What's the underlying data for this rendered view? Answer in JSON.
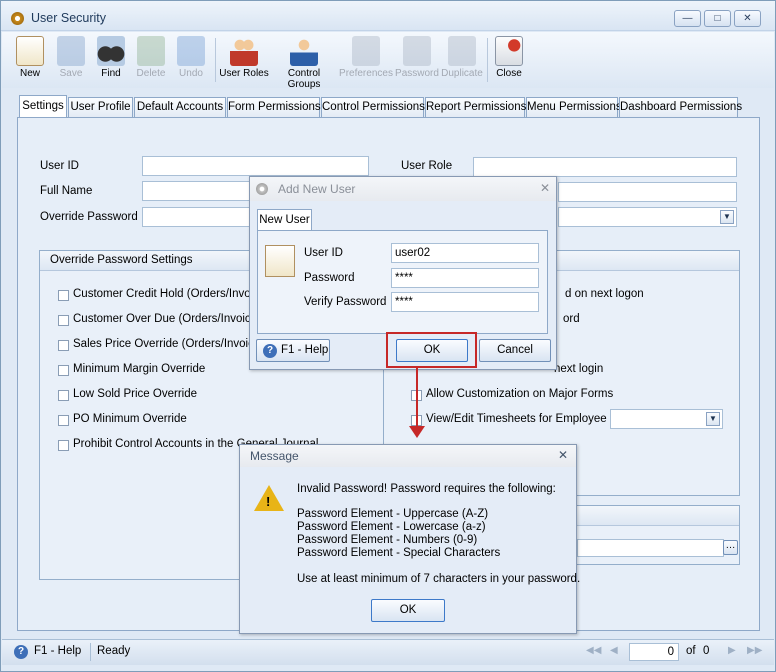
{
  "window": {
    "title": "User Security"
  },
  "toolbar": [
    {
      "label": "New",
      "icon": "new-user-icon",
      "enabled": true
    },
    {
      "label": "Save",
      "icon": "save-icon",
      "enabled": false
    },
    {
      "label": "Find",
      "icon": "binoculars-icon",
      "enabled": true
    },
    {
      "label": "Delete",
      "icon": "recycle-bin-icon",
      "enabled": false
    },
    {
      "label": "Undo",
      "icon": "undo-icon",
      "enabled": false
    },
    {
      "label": "User Roles",
      "icon": "user-roles-icon",
      "enabled": true
    },
    {
      "label": "Control Groups",
      "icon": "control-groups-icon",
      "enabled": true
    },
    {
      "label": "Preferences",
      "icon": "preferences-icon",
      "enabled": false
    },
    {
      "label": "Password",
      "icon": "password-icon",
      "enabled": false
    },
    {
      "label": "Duplicate",
      "icon": "duplicate-icon",
      "enabled": false
    },
    {
      "label": "Close",
      "icon": "close-icon",
      "enabled": true
    }
  ],
  "tabs": [
    "Settings",
    "User Profile",
    "Default Accounts",
    "Form Permissions",
    "Control Permissions",
    "Report Permissions",
    "Menu Permissions",
    "Dashboard Permissions"
  ],
  "form": {
    "user_id_label": "User ID",
    "user_id_value": "",
    "full_name_label": "Full Name",
    "override_password_label": "Override Password",
    "user_role_label": "User Role"
  },
  "override_group": {
    "title": "Override Password Settings",
    "items": [
      "Customer Credit Hold (Orders/Invoice",
      "Customer Over Due (Orders/Invoices",
      "Sales Price Override (Orders/Invoices",
      "Minimum Margin Override",
      "Low Sold Price Override",
      "PO Minimum Override",
      "Prohibit Control Accounts in the General Journal"
    ]
  },
  "right_group": {
    "items_partial": [
      "d on next logon",
      "ord",
      "next login"
    ],
    "items": [
      "Allow Customization on Major Forms",
      "View/Edit Timesheets for Employee"
    ]
  },
  "statusbar": {
    "help": "F1 - Help",
    "status": "Ready",
    "page": "0",
    "of": "of",
    "total": "0"
  },
  "add_user_dialog": {
    "title": "Add New User",
    "tab": "New User",
    "user_id_label": "User ID",
    "user_id_value": "user02",
    "password_label": "Password",
    "password_value": "****",
    "verify_label": "Verify Password",
    "verify_value": "****",
    "help": "F1 - Help",
    "ok": "OK",
    "cancel": "Cancel"
  },
  "message_dialog": {
    "title": "Message",
    "line1": "Invalid Password! Password requires the following:",
    "elements": [
      "Password Element - Uppercase (A-Z)",
      "Password Element - Lowercase (a-z)",
      "Password Element - Numbers (0-9)",
      "Password Element - Special Characters"
    ],
    "footer": "Use at least minimum of 7 characters in your password.",
    "ok": "OK"
  },
  "colors": {
    "highlight": "#c62828",
    "accent": "#3e6fb8"
  }
}
